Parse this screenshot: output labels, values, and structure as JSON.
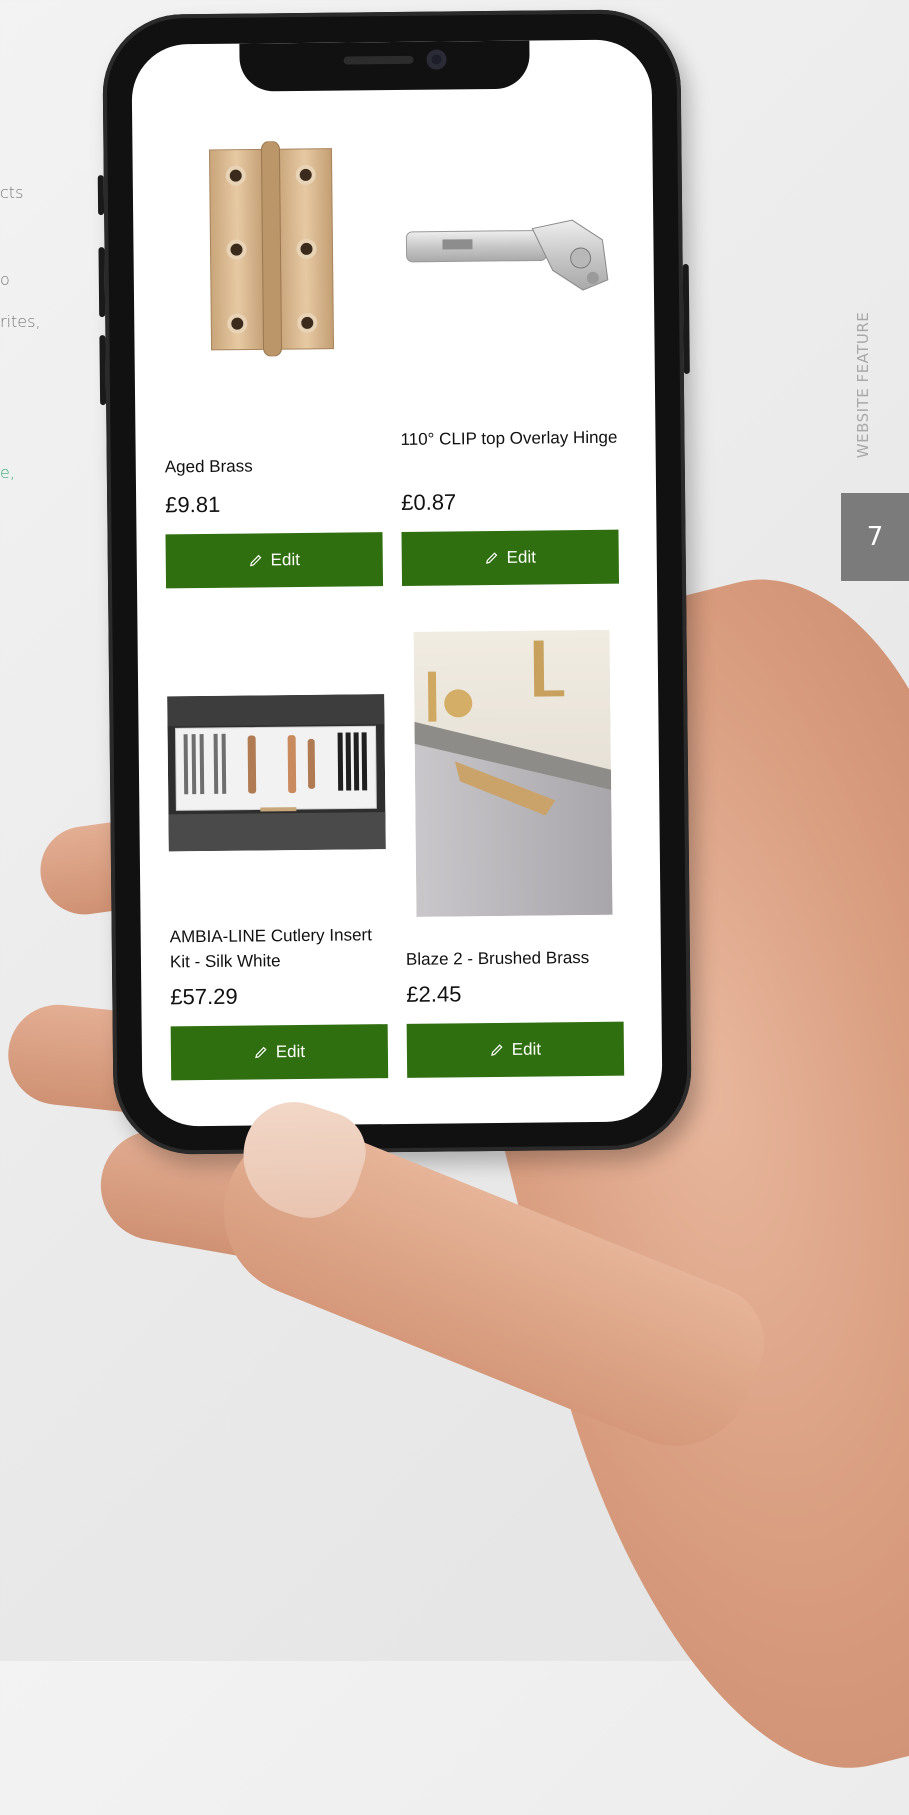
{
  "margin_snippets": [
    {
      "text": "cts",
      "accent": false
    },
    {
      "text": "o",
      "accent": false
    },
    {
      "text": "rites,",
      "accent": false
    },
    {
      "text": "e,",
      "accent": true
    }
  ],
  "side_label": "WEBSITE FEATURE",
  "page_number": "7",
  "products": [
    {
      "name": "Aged Brass",
      "price": "£9.81",
      "edit_label": "Edit"
    },
    {
      "name": "110° CLIP top Overlay Hinge",
      "price": "£0.87",
      "edit_label": "Edit"
    },
    {
      "name": "AMBIA-LINE Cutlery Insert Kit - Silk White",
      "price": "£57.29",
      "edit_label": "Edit"
    },
    {
      "name": "Blaze 2 - Brushed Brass",
      "price": "£2.45",
      "edit_label": "Edit"
    }
  ],
  "colors": {
    "button": "#2f6f0f",
    "accent_text": "#2fae74",
    "page_badge": "#7b7b7b"
  }
}
